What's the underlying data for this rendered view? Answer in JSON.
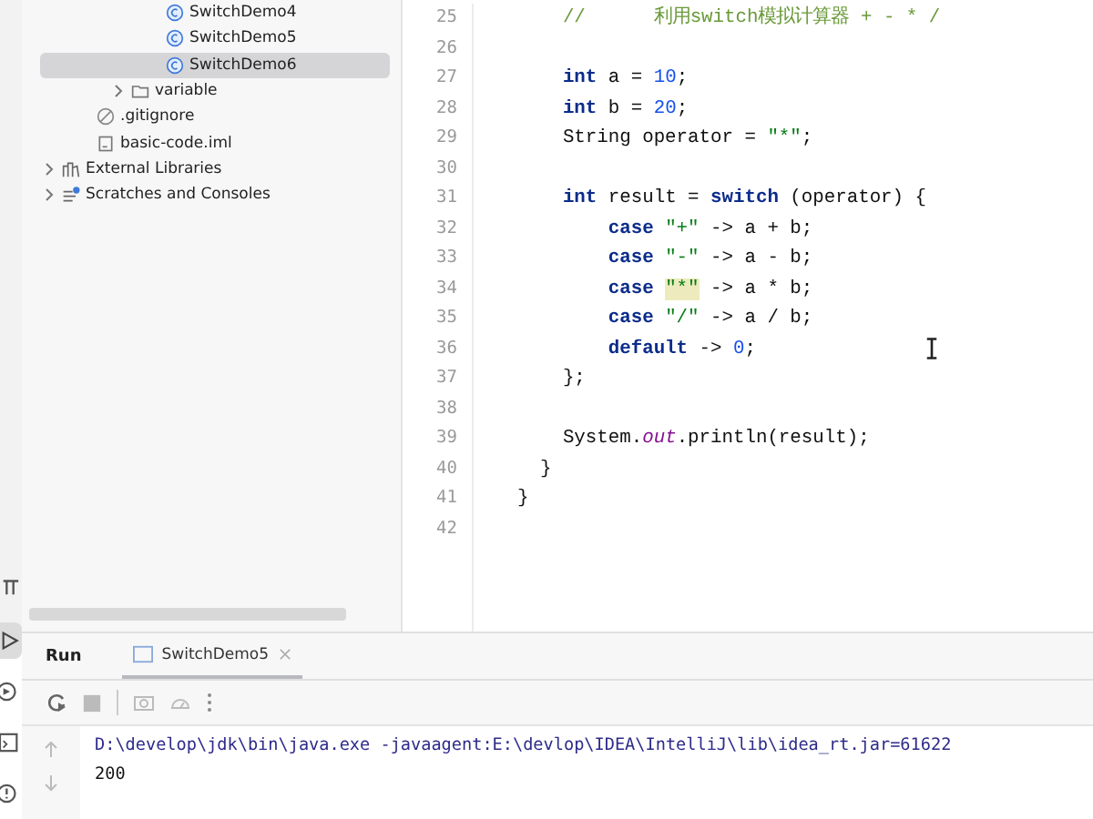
{
  "project_tree": [
    {
      "children": [
        {
          "children": [
            {
              "children": [
                {
                  "label": "SwitchDemo4",
                  "kind": "class",
                  "selected": false
                },
                {
                  "label": "SwitchDemo5",
                  "kind": "class",
                  "selected": false
                },
                {
                  "label": "SwitchDemo6",
                  "kind": "class",
                  "selected": true
                }
              ]
            },
            {
              "label": "variable",
              "kind": "package",
              "selected": false,
              "expanded": false
            }
          ]
        },
        {
          "label": ".gitignore",
          "kind": "ignore",
          "selected": false
        },
        {
          "label": "basic-code.iml",
          "kind": "file",
          "selected": false
        }
      ]
    },
    {
      "label": "External Libraries",
      "kind": "libraries",
      "selected": false,
      "expanded": false
    },
    {
      "label": "Scratches and Consoles",
      "kind": "scratches",
      "selected": false,
      "expanded": false
    }
  ],
  "editor": {
    "lines": [
      {
        "number": "25",
        "tokens": [
          {
            "kind": "comment",
            "text": "    //      利用switch模拟计算器 + - * /"
          }
        ]
      },
      {
        "number": "26"
      },
      {
        "number": "27",
        "tokens": [
          {
            "kind": "keyword",
            "text": "    int"
          },
          {
            "kind": "plain",
            "text": " a = "
          },
          {
            "kind": "number",
            "text": "10"
          },
          {
            "kind": "plain",
            "text": ";"
          }
        ]
      },
      {
        "number": "28",
        "tokens": [
          {
            "kind": "keyword",
            "text": "    int"
          },
          {
            "kind": "plain",
            "text": " b = "
          },
          {
            "kind": "number",
            "text": "20"
          },
          {
            "kind": "plain",
            "text": ";"
          }
        ]
      },
      {
        "number": "29",
        "tokens": [
          {
            "kind": "plain",
            "text": "    String operator = "
          },
          {
            "kind": "string",
            "text": "\"*\""
          },
          {
            "kind": "plain",
            "text": ";"
          }
        ]
      },
      {
        "number": "30"
      },
      {
        "number": "31",
        "tokens": [
          {
            "kind": "keyword",
            "text": "    int"
          },
          {
            "kind": "plain",
            "text": " result = "
          },
          {
            "kind": "keyword",
            "text": "switch"
          },
          {
            "kind": "plain",
            "text": " (operator) {"
          }
        ]
      },
      {
        "number": "32",
        "tokens": [
          {
            "kind": "keyword",
            "text": "        case "
          },
          {
            "kind": "string",
            "text": "\"+\""
          },
          {
            "kind": "plain",
            "text": " -> a + b;"
          }
        ]
      },
      {
        "number": "33",
        "tokens": [
          {
            "kind": "keyword",
            "text": "        case "
          },
          {
            "kind": "string",
            "text": "\"-\""
          },
          {
            "kind": "plain",
            "text": " -> a - b;"
          }
        ]
      },
      {
        "number": "34",
        "tokens": [
          {
            "kind": "keyword",
            "text": "        case "
          },
          {
            "kind": "string_highlighted",
            "text": "\"*\""
          },
          {
            "kind": "plain",
            "text": " -> a * b;"
          }
        ]
      },
      {
        "number": "35",
        "tokens": [
          {
            "kind": "keyword",
            "text": "        case "
          },
          {
            "kind": "string",
            "text": "\"/\""
          },
          {
            "kind": "plain",
            "text": " -> a / b;"
          }
        ]
      },
      {
        "number": "36",
        "tokens": [
          {
            "kind": "keyword",
            "text": "        default"
          },
          {
            "kind": "plain",
            "text": " -> "
          },
          {
            "kind": "number",
            "text": "0"
          },
          {
            "kind": "plain",
            "text": ";"
          }
        ]
      },
      {
        "number": "37",
        "tokens": [
          {
            "kind": "plain",
            "text": "    };"
          }
        ]
      },
      {
        "number": "38"
      },
      {
        "number": "39",
        "tokens": [
          {
            "kind": "plain",
            "text": "    System."
          },
          {
            "kind": "field",
            "text": "out"
          },
          {
            "kind": "plain",
            "text": ".println(result);"
          }
        ]
      },
      {
        "number": "40",
        "tokens": [
          {
            "kind": "plain",
            "text": "  }"
          }
        ]
      },
      {
        "number": "41",
        "tokens": [
          {
            "kind": "plain",
            "text": "}"
          }
        ]
      },
      {
        "number": "42"
      }
    ]
  },
  "run_panel": {
    "title": "Run",
    "tabs": [
      {
        "label": "SwitchDemo5",
        "selected": true
      }
    ],
    "output": [
      "D:\\develop\\jdk\\bin\\java.exe -javaagent:E:\\devlop\\IDEA\\IntelliJ\\lib\\idea_rt.jar=61622",
      "200"
    ]
  }
}
